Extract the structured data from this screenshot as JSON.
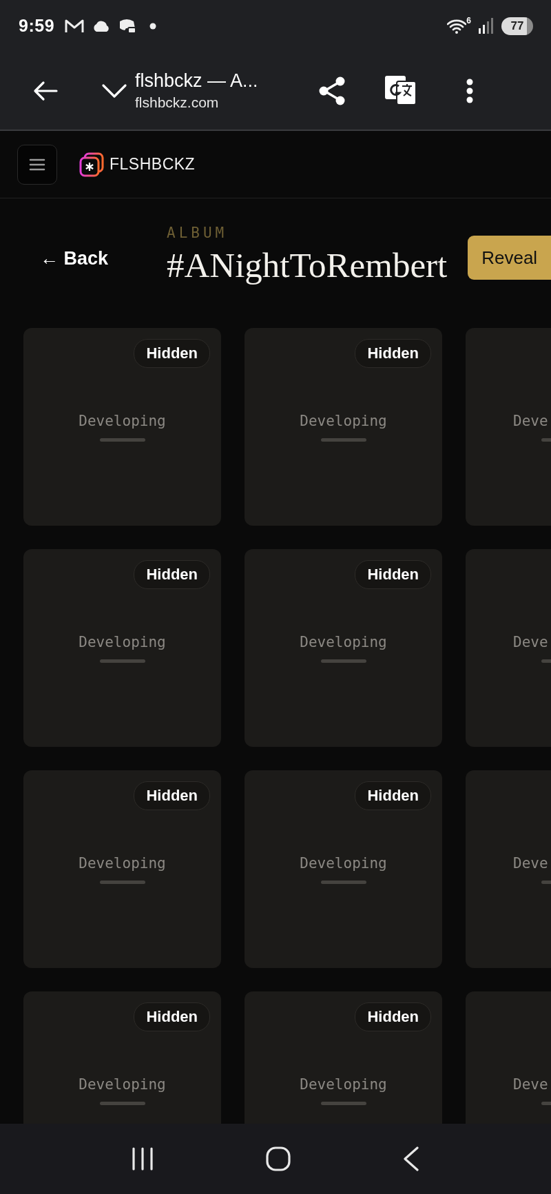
{
  "status_bar": {
    "time": "9:59",
    "wifi_badge": "6",
    "battery": "77"
  },
  "browser_bar": {
    "title": "flshbckz — A...",
    "url": "flshbckz.com"
  },
  "site_header": {
    "logo": "FLSHBCKZ"
  },
  "album": {
    "back": "← Back",
    "eyebrow": "ALBUM",
    "title": "#ANightToRembert",
    "reveal": "Reveal"
  },
  "grid": {
    "rows": [
      [
        {
          "kind": "full",
          "badge": "Hidden",
          "label": "Developing"
        },
        {
          "kind": "full",
          "badge": "Hidden",
          "label": "Developing"
        },
        {
          "kind": "cut",
          "label": "Deve"
        }
      ],
      [
        {
          "kind": "full",
          "badge": "Hidden",
          "label": "Developing"
        },
        {
          "kind": "full",
          "badge": "Hidden",
          "label": "Developing"
        },
        {
          "kind": "cut",
          "label": "Deve"
        }
      ],
      [
        {
          "kind": "full",
          "badge": "Hidden",
          "label": "Developing"
        },
        {
          "kind": "full",
          "badge": "Hidden",
          "label": "Developing"
        },
        {
          "kind": "cut",
          "label": "Deve"
        }
      ],
      [
        {
          "kind": "full",
          "badge": "Hidden",
          "label": "Developing"
        },
        {
          "kind": "full",
          "badge": "Hidden",
          "label": "Developing"
        },
        {
          "kind": "cut",
          "label": "Deve"
        }
      ]
    ]
  }
}
